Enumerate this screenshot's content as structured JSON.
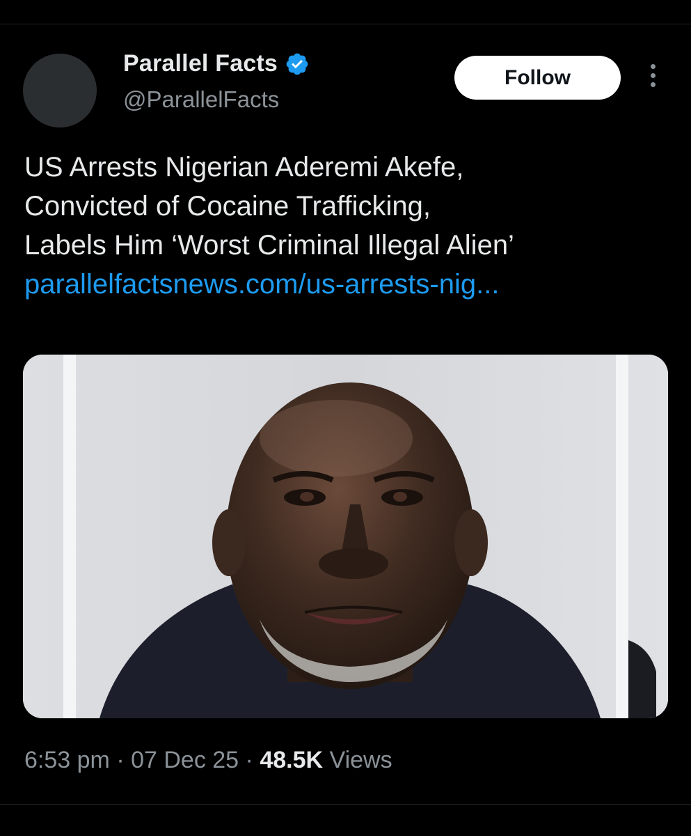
{
  "author": {
    "display_name": "Parallel Facts",
    "handle": "@ParallelFacts",
    "verified_icon": "verified-badge-icon",
    "follow_label": "Follow",
    "more_icon": "more-options-icon"
  },
  "tweet": {
    "lines": [
      "US Arrests Nigerian Aderemi Akefe,",
      "Convicted of Cocaine Trafficking,",
      "Labels Him ‘Worst Criminal Illegal Alien’"
    ],
    "link": "parallelfactsnews.com/us-arrests-nig..."
  },
  "meta": {
    "time": "6:53 pm",
    "separator": "·",
    "date": "07 Dec 25",
    "views_count": "48.5K",
    "views_label": "Views"
  },
  "colors": {
    "background": "#000000",
    "text_primary": "#e7e9ea",
    "text_secondary": "#8b9298",
    "link": "#1d9bf0",
    "verified": "#1d9bf0",
    "follow_bg": "#ffffff"
  }
}
